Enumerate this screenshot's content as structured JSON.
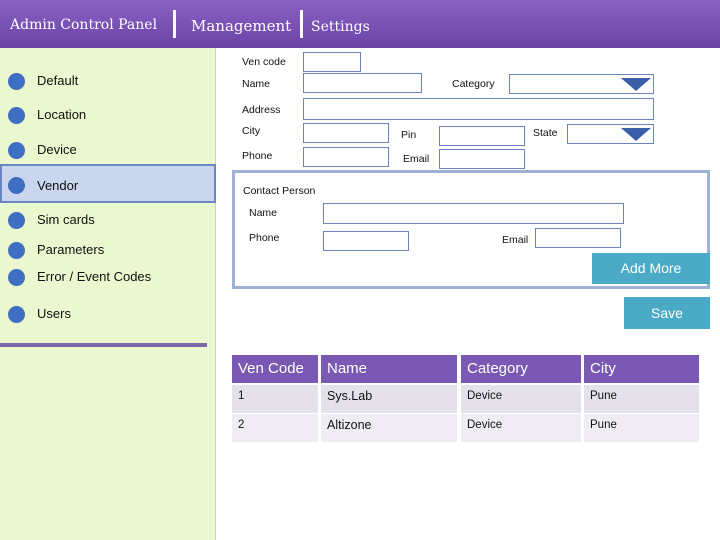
{
  "header": {
    "title": "Admin Control Panel",
    "management": "Management",
    "settings": "Settings"
  },
  "sidebar": {
    "items": [
      {
        "label": "Default"
      },
      {
        "label": "Location"
      },
      {
        "label": "Device"
      },
      {
        "label": "Vendor",
        "active": true
      },
      {
        "label": "Sim cards"
      },
      {
        "label": "Parameters"
      },
      {
        "label": "Error / Event Codes"
      },
      {
        "label": "Users"
      }
    ]
  },
  "form": {
    "ven_code_label": "Ven code",
    "name_label": "Name",
    "category_label": "Category",
    "address_label": "Address",
    "city_label": "City",
    "pin_label": "Pin",
    "state_label": "State",
    "phone_label": "Phone",
    "email_label": "Email",
    "ven_code_value": "",
    "name_value": "",
    "category_value": "",
    "address_value": "",
    "city_value": "",
    "pin_value": "",
    "state_value": "",
    "phone_value": "",
    "email_value": ""
  },
  "contact": {
    "title": "Contact Person",
    "name_label": "Name",
    "phone_label": "Phone",
    "email_label": "Email",
    "name_value": "",
    "phone_value": "",
    "email_value": ""
  },
  "buttons": {
    "add_more": "Add More",
    "save": "Save"
  },
  "table": {
    "headers": [
      "Ven Code",
      "Name",
      "Category",
      "City"
    ],
    "rows": [
      [
        "1",
        "Sys.Lab",
        "Device",
        "Pune"
      ],
      [
        "2",
        "Altizone",
        "Device",
        "Pune"
      ]
    ]
  },
  "colors": {
    "header_purple": "#7a59b4",
    "sidebar_green": "#ebf7cf",
    "nav_dot_blue": "#3f6ec2",
    "button_teal": "#4babc6",
    "field_border": "#6b84bf"
  }
}
